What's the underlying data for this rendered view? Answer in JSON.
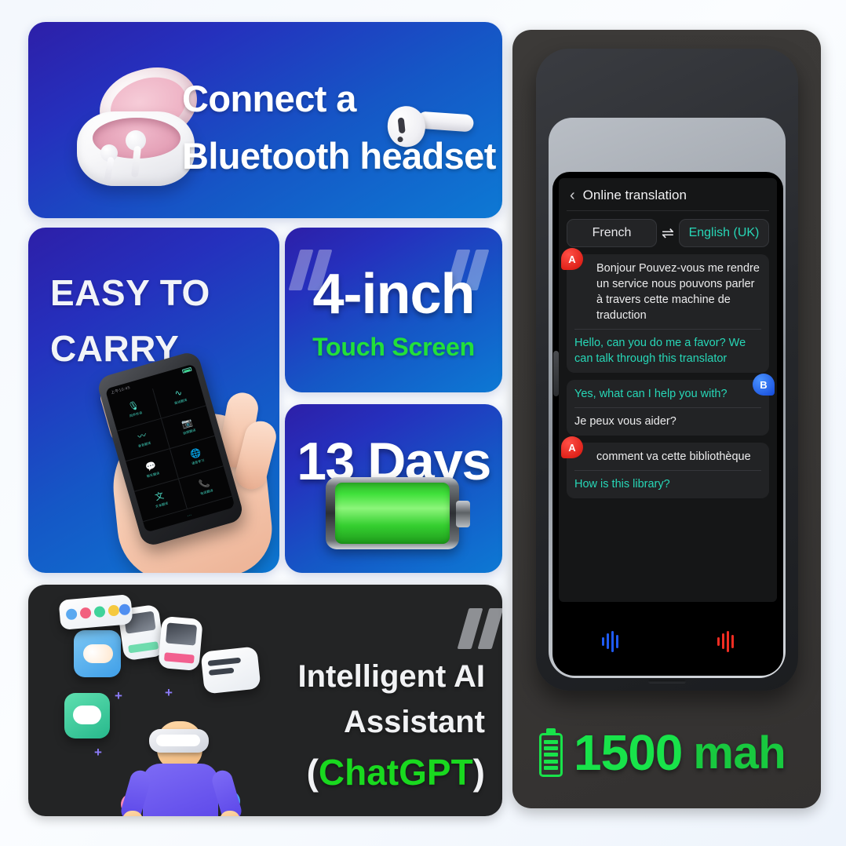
{
  "cards": {
    "bluetooth": {
      "line1": "Connect a",
      "line2": "Bluetooth headset",
      "icon_case": "earbud-charging-case-icon",
      "icon_bud": "single-earbud-icon"
    },
    "carry": {
      "line1": "EASY TO",
      "line2": "CARRY",
      "device_status_time": "上午10:45",
      "apps": [
        {
          "icon": "🎙",
          "label": "同声传译"
        },
        {
          "icon": "∿",
          "label": "离线翻译"
        },
        {
          "icon": "〰",
          "label": "录音翻译"
        },
        {
          "icon": "📷",
          "label": "拍照翻译"
        },
        {
          "icon": "💬",
          "label": "聊天翻译"
        },
        {
          "icon": "🌐",
          "label": "语音学习"
        },
        {
          "icon": "文",
          "label": "文本翻译"
        },
        {
          "icon": "📞",
          "label": "电话翻译"
        }
      ]
    },
    "inch": {
      "main": "4-inch",
      "sub": "Touch Screen",
      "quote_mark": "quote-mark-icon"
    },
    "days": {
      "main": "13 Days",
      "battery_icon": "full-battery-icon"
    },
    "ai": {
      "line1": "Intelligent AI",
      "line2": "Assistant",
      "paren_open": "(",
      "brand": "ChatGPT",
      "paren_close": ")",
      "quote_mark": "quote-mark-icon",
      "brand_color": "#19d91f"
    }
  },
  "device": {
    "leds": [
      {
        "name": "blue-status-led",
        "color": "#0a4fd6"
      },
      {
        "name": "red-status-led",
        "color": "#d41a12"
      }
    ],
    "app": {
      "back_label": "‹",
      "title": "Online translation",
      "source_language": "French",
      "target_language": "English (UK)",
      "swap_icon": "⇌",
      "messages": [
        {
          "speaker": "A",
          "side": "left",
          "source": "Bonjour Pouvez-vous me rendre un service nous pouvons parler à travers cette machine de traduction",
          "target": "Hello, can you do me a favor? We can talk through this translator"
        },
        {
          "speaker": "B",
          "side": "right",
          "source": "Yes, what can I help you with?",
          "target": "Je peux vous aider?"
        },
        {
          "speaker": "A",
          "side": "left",
          "source": "comment va cette bibliothèque",
          "target": "How is this library?"
        }
      ],
      "mic_left": "blue-waveform-mic-icon",
      "mic_right": "red-waveform-mic-icon"
    },
    "battery": {
      "icon": "battery-icon",
      "capacity": "1500",
      "unit": "mah",
      "color": "#18e34a"
    }
  }
}
